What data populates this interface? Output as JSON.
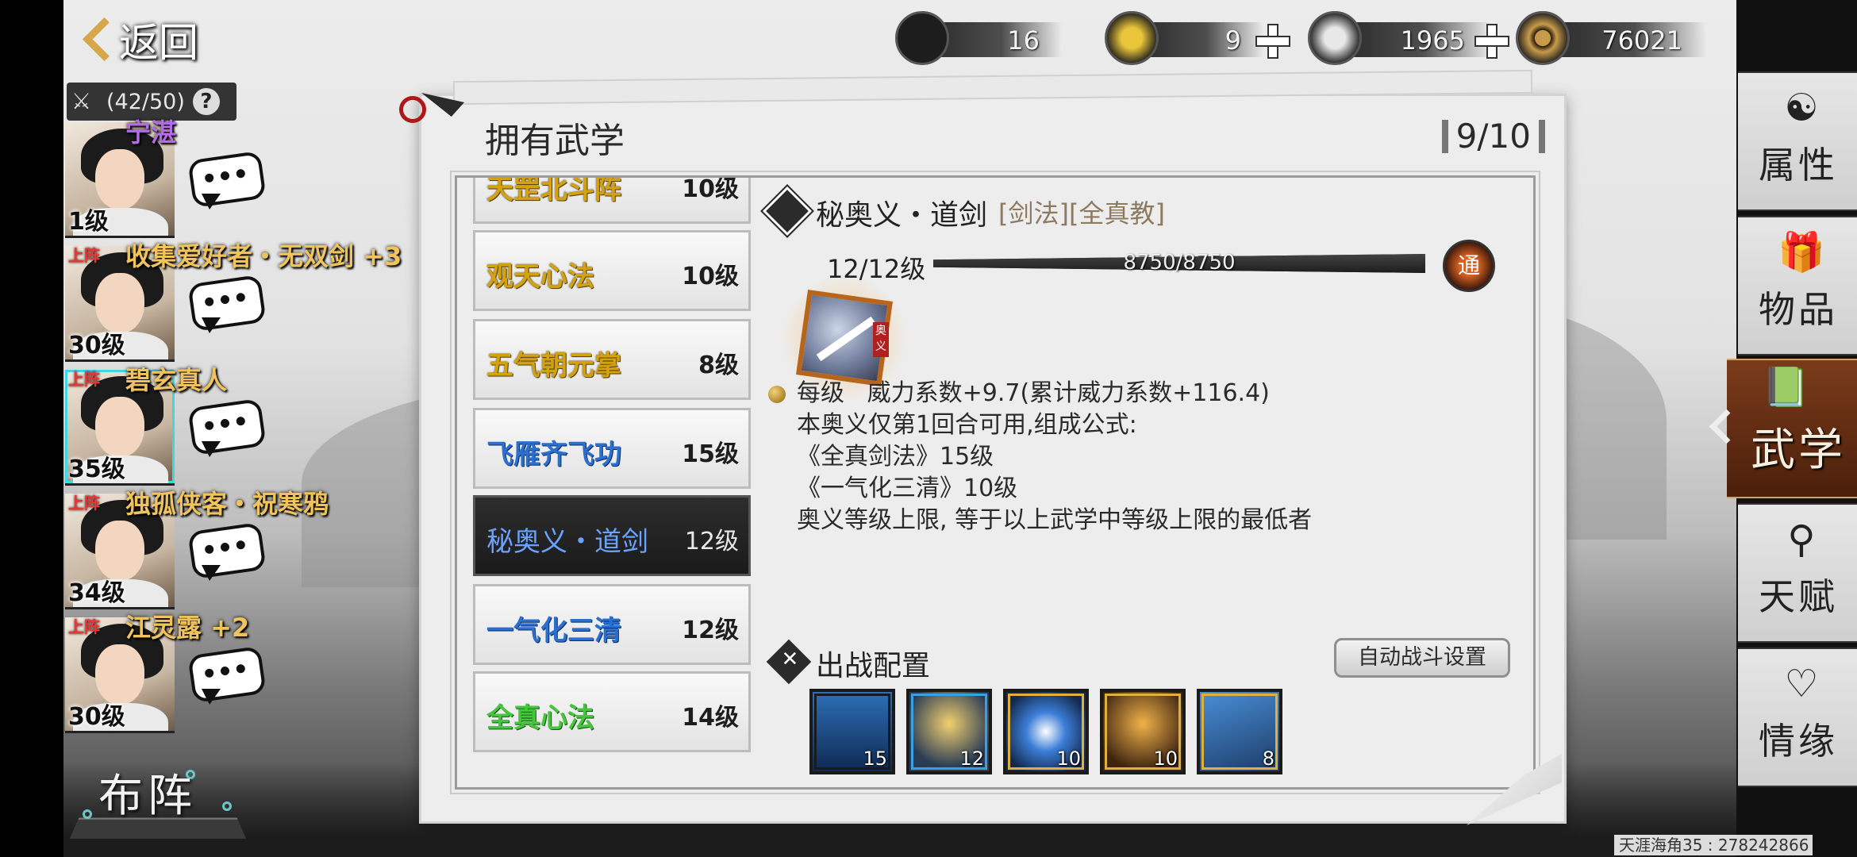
{
  "header": {
    "back_label": "返回",
    "roster_count": "(42/50)",
    "help_label": "?"
  },
  "resources": [
    {
      "icon": "ticket-icon",
      "value": "16"
    },
    {
      "icon": "gold-bar-icon",
      "value": "9"
    },
    {
      "icon": "silver-ingot-icon",
      "value": "1965"
    },
    {
      "icon": "copper-coin-icon",
      "value": "76021"
    }
  ],
  "heroes": [
    {
      "name": "宁湛",
      "level": "1级",
      "tag": "",
      "active": false
    },
    {
      "name": "收集爱好者・无双剑 +3",
      "level": "30级",
      "tag": "上阵",
      "active": false
    },
    {
      "name": "碧玄真人",
      "level": "35级",
      "tag": "上阵",
      "active": true
    },
    {
      "name": "独孤侠客・祝寒鸦",
      "level": "34级",
      "tag": "上阵",
      "active": false
    },
    {
      "name": "江灵露 +2",
      "level": "30级",
      "tag": "上阵",
      "active": false
    }
  ],
  "formation_label": "布阵",
  "tabs": [
    {
      "label": "属性",
      "icon": "mask-icon"
    },
    {
      "label": "物品",
      "icon": "gift-box-icon"
    },
    {
      "label": "武学",
      "icon": "book-icon",
      "active": true
    },
    {
      "label": "天赋",
      "icon": "talent-node-icon"
    },
    {
      "label": "情缘",
      "icon": "heart-knot-icon"
    }
  ],
  "panel": {
    "title": "拥有武学",
    "count": "9/10"
  },
  "skills": [
    {
      "name": "天罡北斗阵",
      "level": "10级",
      "color": "gold"
    },
    {
      "name": "观天心法",
      "level": "10级",
      "color": "gold"
    },
    {
      "name": "五气朝元掌",
      "level": "8级",
      "color": "gold"
    },
    {
      "name": "飞雁齐飞功",
      "level": "15级",
      "color": "blue"
    },
    {
      "name": "秘奥义・道剑",
      "level": "12级",
      "color": "selected"
    },
    {
      "name": "一气化三清",
      "level": "12级",
      "color": "blue"
    },
    {
      "name": "全真心法",
      "level": "14级",
      "color": "green"
    }
  ],
  "detail": {
    "title": "秘奥义・道剑",
    "tags": "[剑法][全真教]",
    "level": "12/12级",
    "xp_text": "8750/8750",
    "xp_fraction": 1.0,
    "badge": "通",
    "seal": "奥义",
    "description": "每级   威力系数+9.7(累计威力系数+116.4)\n本奥义仅第1回合可用,组成公式:\n《全真剑法》15级\n《一气化三清》10级\n奥义等级上限, 等于以上武学中等级上限的最低者"
  },
  "deploy": {
    "title": "出战配置",
    "auto_button": "自动战斗设置",
    "slots": [
      {
        "icon": "sword-light-icon",
        "value": "15",
        "frame": "#1a1a1a"
      },
      {
        "icon": "monk-aura-icon",
        "value": "12",
        "frame": "#3aa0e0"
      },
      {
        "icon": "blue-wave-icon",
        "value": "10",
        "frame": "#e0b03a"
      },
      {
        "icon": "meditation-icon",
        "value": "10",
        "frame": "#e0b03a"
      },
      {
        "icon": "warrior-strike-icon",
        "value": "8",
        "frame": "#e0b03a"
      }
    ]
  },
  "watermark": "天涯海角35 : 278242866"
}
